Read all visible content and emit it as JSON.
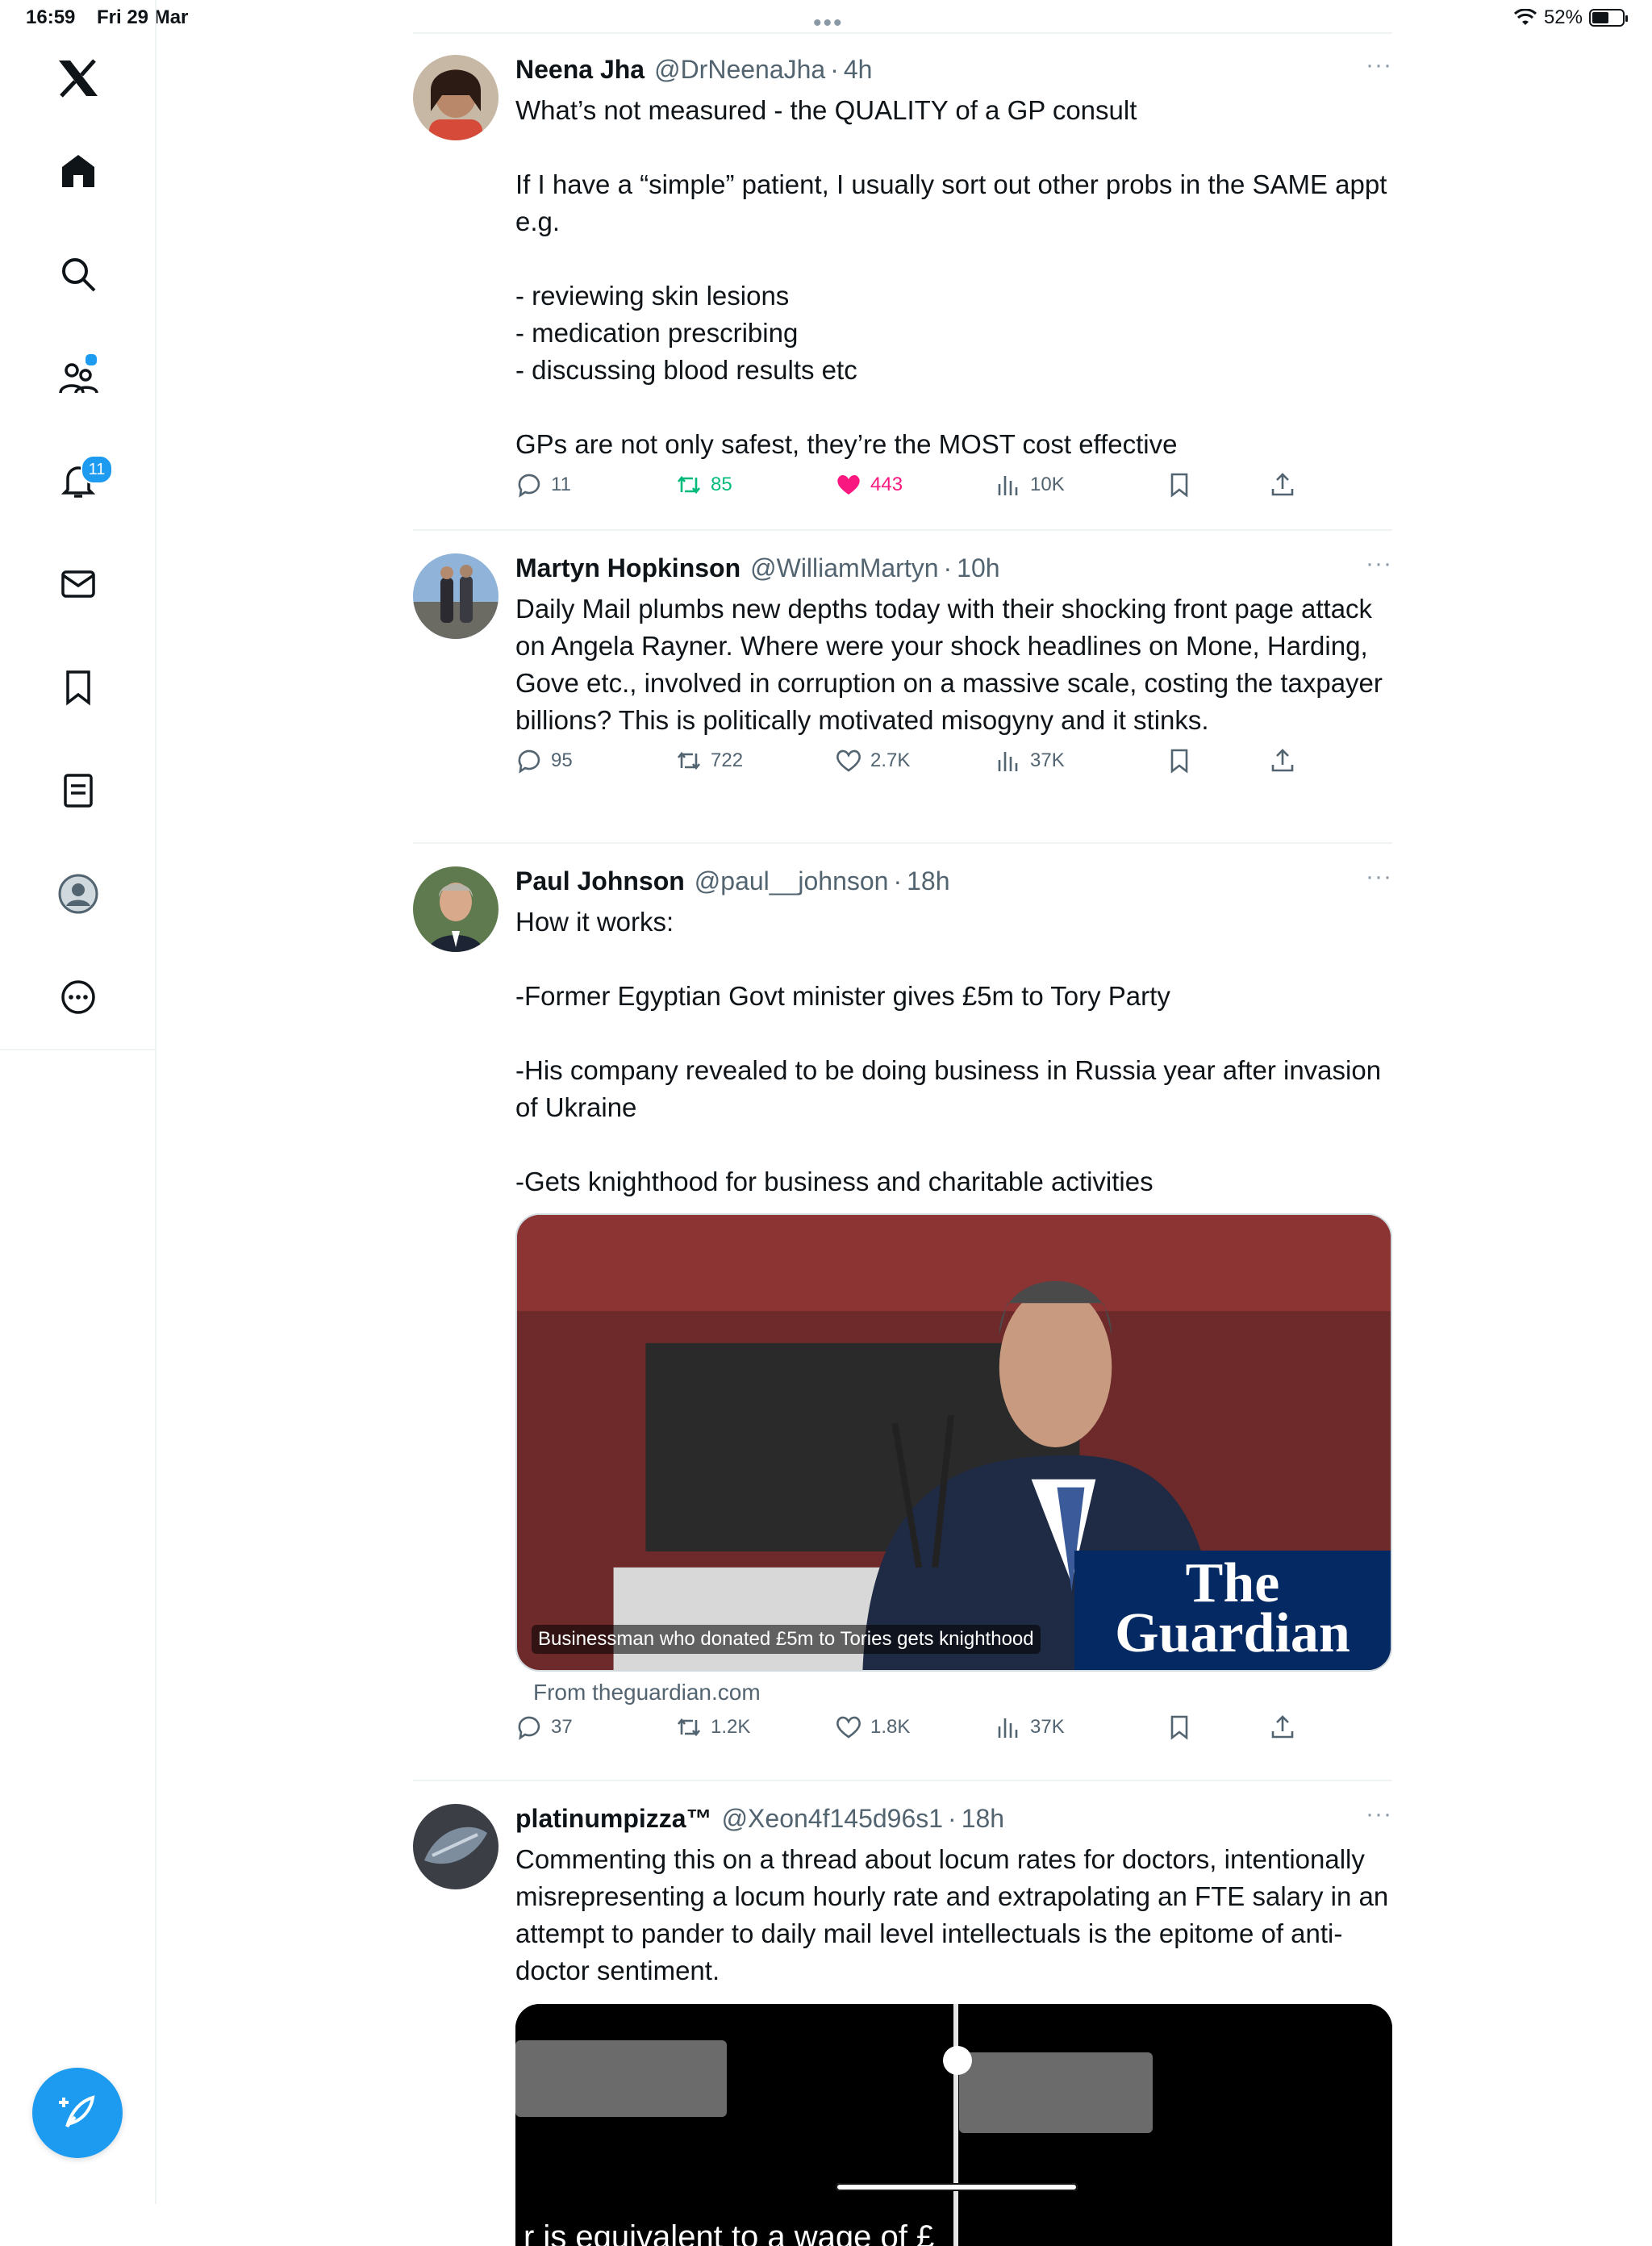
{
  "status_bar": {
    "time": "16:59",
    "date": "Fri 29 Mar",
    "battery": "52%"
  },
  "sidebar": {
    "items": [
      {
        "name": "logo",
        "icon": "x-logo-icon"
      },
      {
        "name": "home",
        "icon": "home-icon"
      },
      {
        "name": "explore",
        "icon": "search-icon"
      },
      {
        "name": "communities",
        "icon": "communities-icon"
      },
      {
        "name": "notifications",
        "icon": "bell-icon",
        "badge": "11"
      },
      {
        "name": "messages",
        "icon": "mail-icon"
      },
      {
        "name": "bookmarks",
        "icon": "bookmark-icon"
      },
      {
        "name": "lists",
        "icon": "list-icon"
      },
      {
        "name": "profile",
        "icon": "avatar-icon"
      },
      {
        "name": "more",
        "icon": "more-circle-icon"
      }
    ],
    "compose_icon": "compose-feather-icon"
  },
  "colors": {
    "accent": "#1d9bf0",
    "like": "#f91880",
    "retweet": "#00ba7c",
    "muted": "#536471"
  },
  "tweets": [
    {
      "name": "Neena Jha",
      "handle": "@DrNeenaJha",
      "time": "4h",
      "text": "What’s not measured - the QUALITY of a GP consult\n\nIf I have a “simple” patient, I usually sort out other probs in the SAME appt e.g.\n\n- reviewing skin lesions\n- medication prescribing\n- discussing blood results etc\n\nGPs are not only safest, they’re the MOST cost effective",
      "replies": "11",
      "retweets": "85",
      "likes": "443",
      "views": "10K"
    },
    {
      "name": "Martyn Hopkinson",
      "handle": "@WilliamMartyn",
      "time": "10h",
      "text": "Daily Mail plumbs new depths today with their shocking front page attack on Angela Rayner. Where were your shock headlines on Mone, Harding, Gove etc., involved in corruption on a massive scale, costing the taxpayer billions? This is politically motivated misogyny and it stinks.",
      "replies": "95",
      "retweets": "722",
      "likes": "2.7K",
      "views": "37K"
    },
    {
      "name": "Paul Johnson",
      "handle": "@paul__johnson",
      "time": "18h",
      "text": "How it works:\n\n-Former Egyptian Govt minister gives £5m to Tory Party\n\n-His company revealed to be doing business in Russia year after invasion of Ukraine\n\n-Gets knighthood for business and charitable activities",
      "card_caption": "Businessman who donated £5m to Tories gets knighthood",
      "card_logo_line1": "The",
      "card_logo_line2": "Guardian",
      "card_source": "From theguardian.com",
      "replies": "37",
      "retweets": "1.2K",
      "likes": "1.8K",
      "views": "37K"
    },
    {
      "name": "platinumpizza™",
      "handle": "@Xeon4f145d96s1",
      "time": "18h",
      "text": "Commenting this on a thread about locum rates for doctors, intentionally misrepresenting a locum hourly rate and extrapolating an FTE salary in an attempt to pander to daily mail level intellectuals is the epitome of anti-doctor sentiment.",
      "media_subtitle": "r is equivalent to a wage of £"
    }
  ],
  "more_label": "···"
}
